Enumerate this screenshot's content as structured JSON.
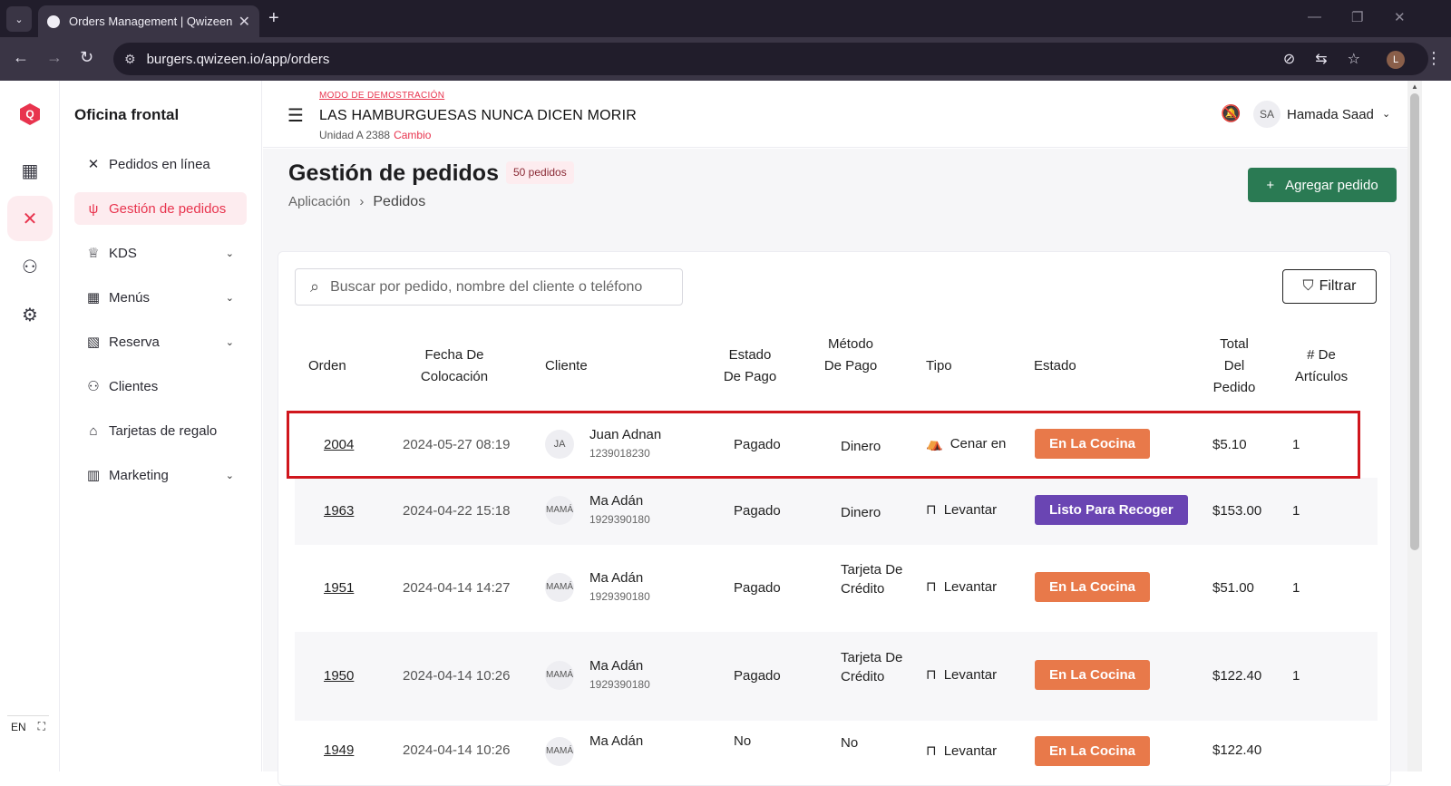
{
  "browser": {
    "tab_title": "Orders Management | Qwizeen",
    "url": "burgers.qwizeen.io/app/orders",
    "profile_initial": "L"
  },
  "rail": {
    "lang": "EN"
  },
  "sidenav": {
    "title": "Oficina frontal",
    "items": [
      {
        "label": "Pedidos en línea",
        "icon": "fork-knife-crossed-icon"
      },
      {
        "label": "Gestión de pedidos",
        "icon": "fork-knife-icon",
        "active": true
      },
      {
        "label": "KDS",
        "icon": "chef-hat-icon"
      },
      {
        "label": "Menús",
        "icon": "grid-icon"
      },
      {
        "label": "Reserva",
        "icon": "table-icon"
      },
      {
        "label": "Clientes",
        "icon": "people-icon"
      },
      {
        "label": "Tarjetas de regalo",
        "icon": "gift-icon"
      },
      {
        "label": "Marketing",
        "icon": "bar-chart-icon"
      }
    ]
  },
  "header": {
    "demo_mode": "MODO DE DEMOSTRACIÓN",
    "restaurant": "LAS HAMBURGUESAS NUNCA DICEN MORIR",
    "unit": "Unidad A 2388",
    "change": "Cambio",
    "user_initials": "SA",
    "user_name": "Hamada Saad"
  },
  "page": {
    "title": "Gestión de pedidos",
    "count_badge": "50 pedidos",
    "breadcrumb": [
      "Aplicación",
      "Pedidos"
    ],
    "add_button": "Agregar pedido",
    "search_placeholder": "Buscar por pedido, nombre del cliente o teléfono",
    "filter_button": "Filtrar"
  },
  "table": {
    "headers": {
      "order": "Orden",
      "date": "Fecha De Colocación",
      "customer": "Cliente",
      "pay_status": "Estado De Pago",
      "pay_method": "Método De Pago",
      "type": "Tipo",
      "status": "Estado",
      "total": "Total Del Pedido",
      "items": "# De Artículos"
    },
    "rows": [
      {
        "order": "2004",
        "date": "2024-05-27 08:19",
        "initials": "JA",
        "name": "Juan Adnan",
        "phone": "1239018230",
        "pay": "Pagado",
        "method": "Dinero",
        "type": "Cenar en",
        "status": "En La Cocina",
        "total": "$5.10",
        "items": "1"
      },
      {
        "order": "1963",
        "date": "2024-04-22 15:18",
        "initials": "MAMÁ",
        "name": "Ma Adán",
        "phone": "1929390180",
        "pay": "Pagado",
        "method": "Dinero",
        "type": "Levantar",
        "status": "Listo Para Recoger",
        "total": "$153.00",
        "items": "1"
      },
      {
        "order": "1951",
        "date": "2024-04-14 14:27",
        "initials": "MAMÁ",
        "name": "Ma Adán",
        "phone": "1929390180",
        "pay": "Pagado",
        "method": "Tarjeta De Crédito",
        "type": "Levantar",
        "status": "En La Cocina",
        "total": "$51.00",
        "items": "1"
      },
      {
        "order": "1950",
        "date": "2024-04-14 10:26",
        "initials": "MAMÁ",
        "name": "Ma Adán",
        "phone": "1929390180",
        "pay": "Pagado",
        "method": "Tarjeta De Crédito",
        "type": "Levantar",
        "status": "En La Cocina",
        "total": "$122.40",
        "items": "1"
      },
      {
        "order": "1949",
        "date": "2024-04-14 10:26",
        "initials": "MAMÁ",
        "name": "Ma Adán",
        "phone": "",
        "pay": "No",
        "method": "No",
        "type": "Levantar",
        "status": "En La Cocina",
        "total": "$122.40",
        "items": ""
      }
    ]
  },
  "colors": {
    "accent": "#e8344e",
    "primary_green": "#2a7a53",
    "status_kitchen": "#e8794a",
    "status_ready": "#6a45b3",
    "highlight": "#d0161d"
  }
}
